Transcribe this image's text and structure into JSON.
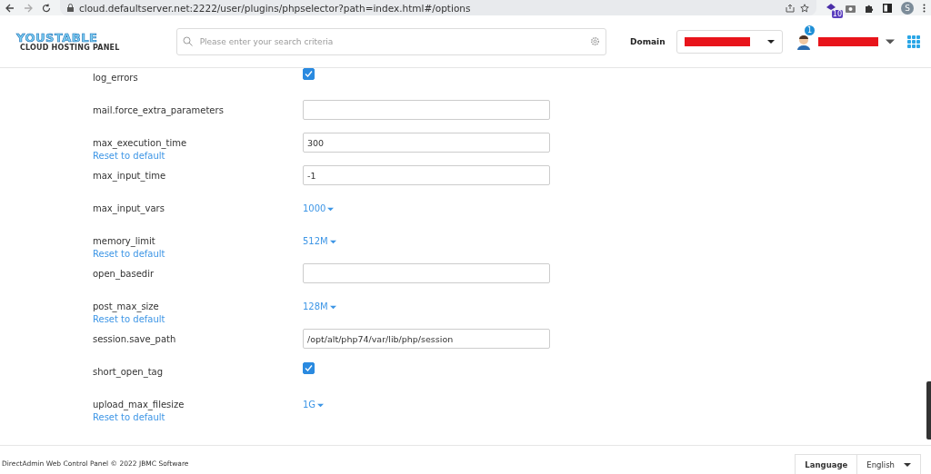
{
  "browser": {
    "url": "cloud.defaultserver.net:2222/user/plugins/phpselector?path=index.html#/options",
    "extension_badge": "10",
    "profile_initial": "S"
  },
  "header": {
    "logo_title": "YOUSTABLE",
    "logo_subtitle": "CLOUD HOSTING PANEL",
    "search": {
      "placeholder": "Please enter your search criteria"
    },
    "domain_label": "Domain",
    "notification_count": "1"
  },
  "options": [
    {
      "name": "log_errors",
      "kind": "checkbox",
      "checked": true
    },
    {
      "name": "mail.force_extra_parameters",
      "kind": "text"
    },
    {
      "name": "max_execution_time",
      "kind": "text",
      "value": "300",
      "reset": "Reset to default"
    },
    {
      "name": "max_input_time",
      "kind": "text",
      "value": "-1"
    },
    {
      "name": "max_input_vars",
      "kind": "select",
      "value": "1000"
    },
    {
      "name": "memory_limit",
      "kind": "select",
      "value": "512M",
      "reset": "Reset to default"
    },
    {
      "name": "open_basedir",
      "kind": "text"
    },
    {
      "name": "post_max_size",
      "kind": "select",
      "value": "128M",
      "reset": "Reset to default"
    },
    {
      "name": "session.save_path",
      "kind": "text",
      "value": "/opt/alt/php74/var/lib/php/session"
    },
    {
      "name": "short_open_tag",
      "kind": "checkbox",
      "checked": true
    },
    {
      "name": "upload_max_filesize",
      "kind": "select",
      "value": "1G",
      "reset": "Reset to default"
    }
  ],
  "footer": {
    "copyright": "DirectAdmin Web Control Panel © 2022 JBMC Software",
    "language_label": "Language",
    "language": "English"
  }
}
